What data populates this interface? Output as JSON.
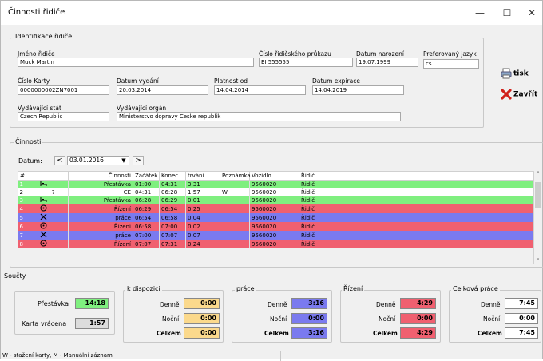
{
  "window": {
    "title": "Činnosti řidiče",
    "minimize": "—",
    "maximize": "☐",
    "close": "✕"
  },
  "driver": {
    "group": "Identifikace řidiče",
    "name_label": "Jméno řidiče",
    "name": "Muck Martin",
    "card_id_label": "Číslo řidičského průkazu",
    "card_id": "EI 555555",
    "birth_label": "Datum narození",
    "birth": "19.07.1999",
    "lang_label": "Preferovaný jazyk",
    "lang": "cs",
    "card_no_label": "Číslo Karty",
    "card_no": "0000000002ZN7001",
    "issued_label": "Datum vydání",
    "issued": "20.03.2014",
    "valid_label": "Platnost od",
    "valid": "14.04.2014",
    "expiry_label": "Datum expirace",
    "expiry": "14.04.2019",
    "state_label": "Vydávající stát",
    "state": "Czech Republic",
    "authority_label": "Vydávající orgán",
    "authority": "Ministerstvo dopravy Ceske republik"
  },
  "side": {
    "print": "tisk",
    "close": "Zavřít"
  },
  "activities": {
    "group": "Činnosti",
    "date_label": "Datum:",
    "prev": "<",
    "next": ">",
    "date": "03.01.2016",
    "columns": [
      "#",
      "",
      "Činnosti",
      "Začátek",
      "Konec",
      "trvání",
      "Poznámka",
      "Vozidlo",
      "Řidič"
    ],
    "rows": [
      {
        "n": "1",
        "icon": "bed",
        "act": "Přestávka",
        "start": "01:00",
        "end": "04:31",
        "dur": "3:31",
        "note": "",
        "veh": "9560020",
        "drv": "Řidič",
        "color": "green"
      },
      {
        "n": "2",
        "icon": "?",
        "act": "CE",
        "start": "04:31",
        "end": "06:28",
        "dur": "1:57",
        "note": "W",
        "veh": "9560020",
        "drv": "Řidič",
        "color": "white"
      },
      {
        "n": "3",
        "icon": "bed",
        "act": "Přestávka",
        "start": "06:28",
        "end": "06:29",
        "dur": "0:01",
        "note": "",
        "veh": "9560020",
        "drv": "Řidič",
        "color": "green"
      },
      {
        "n": "4",
        "icon": "wheel",
        "act": "Řízení",
        "start": "06:29",
        "end": "06:54",
        "dur": "0:25",
        "note": "",
        "veh": "9560020",
        "drv": "Řidič",
        "color": "red"
      },
      {
        "n": "5",
        "icon": "tools",
        "act": "práce",
        "start": "06:54",
        "end": "06:58",
        "dur": "0:04",
        "note": "",
        "veh": "9560020",
        "drv": "Řidič",
        "color": "blue"
      },
      {
        "n": "6",
        "icon": "wheel",
        "act": "Řízení",
        "start": "06:58",
        "end": "07:00",
        "dur": "0:02",
        "note": "",
        "veh": "9560020",
        "drv": "Řidič",
        "color": "red"
      },
      {
        "n": "7",
        "icon": "tools",
        "act": "práce",
        "start": "07:00",
        "end": "07:07",
        "dur": "0:07",
        "note": "",
        "veh": "9560020",
        "drv": "Řidič",
        "color": "blue"
      },
      {
        "n": "8",
        "icon": "wheel",
        "act": "Řízení",
        "start": "07:07",
        "end": "07:31",
        "dur": "0:24",
        "note": "",
        "veh": "9560020",
        "drv": "Řidič",
        "color": "red"
      }
    ]
  },
  "sums": {
    "group": "Součty",
    "break_label": "Přestávka",
    "break_val": "14:18",
    "card_ret_label": "Karta vrácena",
    "card_ret_val": "1:57",
    "avail": {
      "title": "k dispozici",
      "day": "0:00",
      "night": "0:00",
      "total": "0:00"
    },
    "work": {
      "title": "práce",
      "day": "3:16",
      "night": "0:00",
      "total": "3:16"
    },
    "drive": {
      "title": "Řízení",
      "day": "4:29",
      "night": "0:00",
      "total": "4:29"
    },
    "overall": {
      "title": "Celková práce",
      "day": "7:45",
      "night": "0:00",
      "total": "7:45"
    },
    "day_label": "Denně",
    "night_label": "Noční",
    "total_label": "Celkem"
  },
  "status": {
    "text": "W - stažení karty, M - Manuální záznam"
  },
  "colors": {
    "green": "#7fef7f",
    "red": "#f06070",
    "blue": "#7a7aef",
    "yellow": "#fbd98c",
    "grey": "#dcdcdc"
  }
}
